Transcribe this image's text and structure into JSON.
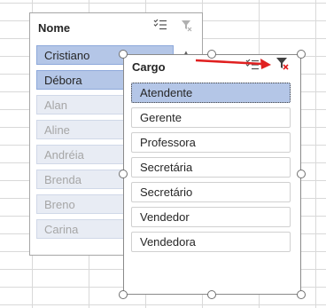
{
  "slicer_nome": {
    "title": "Nome",
    "items": [
      {
        "label": "Cristiano",
        "state": "selected"
      },
      {
        "label": "Débora",
        "state": "selected"
      },
      {
        "label": "Alan",
        "state": "no-data"
      },
      {
        "label": "Aline",
        "state": "no-data"
      },
      {
        "label": "Andréia",
        "state": "no-data"
      },
      {
        "label": "Brenda",
        "state": "no-data"
      },
      {
        "label": "Breno",
        "state": "no-data"
      },
      {
        "label": "Carina",
        "state": "no-data"
      }
    ],
    "icons": [
      "multi-select-icon",
      "clear-filter-icon"
    ]
  },
  "slicer_cargo": {
    "title": "Cargo",
    "items": [
      {
        "label": "Atendente",
        "state": "selected"
      },
      {
        "label": "Gerente",
        "state": "available"
      },
      {
        "label": "Professora",
        "state": "available"
      },
      {
        "label": "Secretária",
        "state": "available"
      },
      {
        "label": "Secretário",
        "state": "available"
      },
      {
        "label": "Vendedor",
        "state": "available"
      },
      {
        "label": "Vendedora",
        "state": "available"
      }
    ],
    "icons": [
      "multi-select-icon",
      "clear-filter-icon"
    ]
  },
  "colors": {
    "selected_fill": "#b4c6e7",
    "selected_border": "#8ea9db",
    "no_data_fill": "#e8ecf4",
    "no_data_text": "#a6a6a6",
    "annotation_arrow": "#e02020",
    "clear_filter_x": "#e02020"
  }
}
